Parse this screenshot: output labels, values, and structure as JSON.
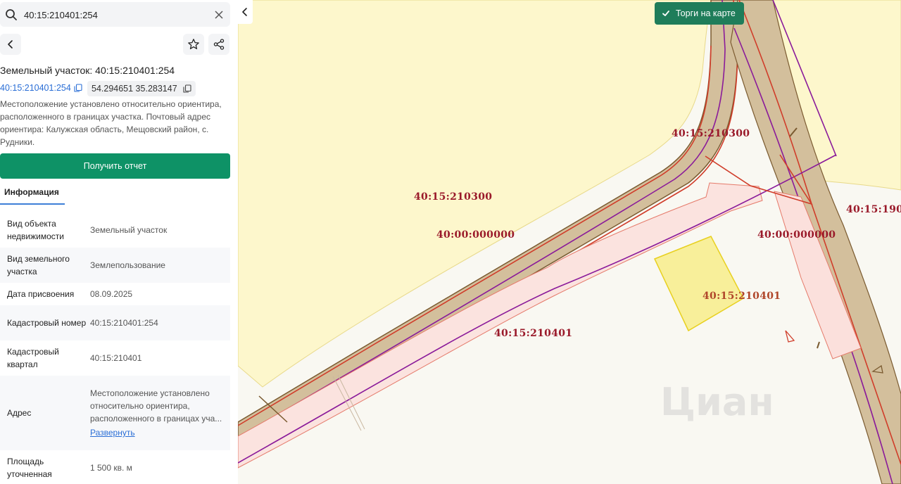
{
  "search": {
    "value": "40:15:210401:254"
  },
  "parcel": {
    "title": "Земельный участок: 40:15:210401:254",
    "cadastral_link": "40:15:210401:254",
    "coordinates": "54.294651 35.283147",
    "description": "Местоположение установлено относительно ориентира, расположенного в границах участка. Почтовый адрес ориентира: Калужская область, Мещовский район, с. Рудники."
  },
  "report_button": "Получить отчет",
  "tabs": [
    {
      "label": "Информация",
      "active": true
    }
  ],
  "info_rows": [
    {
      "label": "Вид объекта недвижимости",
      "value": "Земельный участок"
    },
    {
      "label": "Вид земельного участка",
      "value": "Землепользование"
    },
    {
      "label": "Дата присвоения",
      "value": "08.09.2025"
    },
    {
      "label": "Кадастровый номер",
      "value": "40:15:210401:254"
    },
    {
      "label": "Кадастровый квартал",
      "value": "40:15:210401"
    },
    {
      "label": "Адрес",
      "value": "Местоположение установлено относительно ориентира, расположенного в границах уча...",
      "link": "Развернуть"
    },
    {
      "label": "Площадь уточненная",
      "value": "1 500 кв. м"
    }
  ],
  "map": {
    "toggle_label": "Торги на карте",
    "labels": [
      "40:15:210300",
      "40:15:210300",
      "40:00:000000",
      "40:00:000000",
      "40:15:210401",
      "40:15:210401",
      "40:15:190"
    ],
    "watermark": "Циан"
  },
  "colors": {
    "accent": "#0e9266",
    "link": "#2a6ed6",
    "cadastral_label": "#9a1a2a",
    "toggle_bg": "#1f7d5a"
  },
  "icons": [
    "search-icon",
    "close-icon",
    "back-arrow-icon",
    "star-icon",
    "share-icon",
    "copy-icon",
    "chevron-left-icon",
    "check-icon"
  ]
}
